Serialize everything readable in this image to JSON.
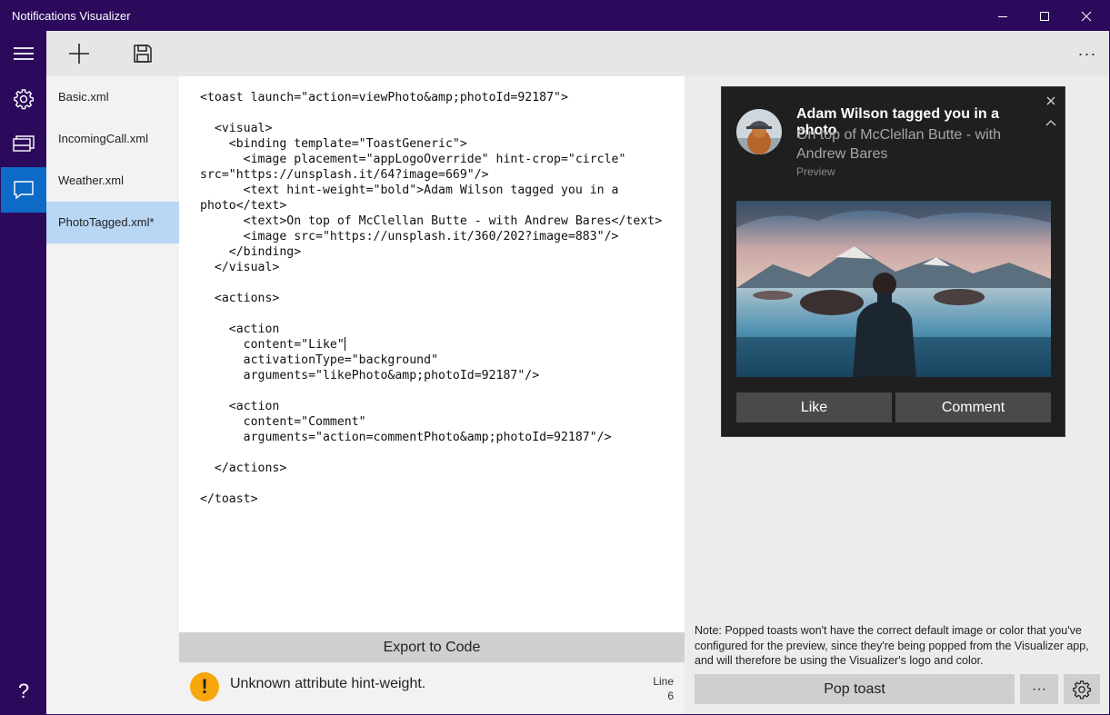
{
  "window": {
    "title": "Notifications Visualizer"
  },
  "nav": {
    "items": [
      {
        "icon": "hamburger-icon"
      },
      {
        "icon": "gear-icon"
      },
      {
        "icon": "gallery-icon"
      },
      {
        "icon": "message-icon",
        "active": true
      }
    ],
    "help_label": "?"
  },
  "toolbar": {
    "more_label": "···"
  },
  "files": [
    {
      "label": "Basic.xml"
    },
    {
      "label": "IncomingCall.xml"
    },
    {
      "label": "Weather.xml"
    },
    {
      "label": "PhotoTagged.xml*",
      "selected": true
    }
  ],
  "editor": {
    "code_before_caret": "<toast launch=\"action=viewPhoto&amp;photoId=92187\">\n\n  <visual>\n    <binding template=\"ToastGeneric\">\n      <image placement=\"appLogoOverride\" hint-crop=\"circle\"\nsrc=\"https://unsplash.it/64?image=669\"/>\n      <text hint-weight=\"bold\">Adam Wilson tagged you in a\nphoto</text>\n      <text>On top of McClellan Butte - with Andrew Bares</text>\n      <image src=\"https://unsplash.it/360/202?image=883\"/>\n    </binding>\n  </visual>\n\n  <actions>\n\n    <action\n      content=\"Like\"",
    "code_after_caret": "\n      activationType=\"background\"\n      arguments=\"likePhoto&amp;photoId=92187\"/>\n\n    <action\n      content=\"Comment\"\n      arguments=\"action=commentPhoto&amp;photoId=92187\"/>\n\n  </actions>\n\n</toast>",
    "export_label": "Export to Code"
  },
  "status": {
    "icon_glyph": "!",
    "message": "Unknown attribute hint-weight.",
    "line_label": "Line",
    "line_number": "6"
  },
  "toast": {
    "title": "Adam Wilson tagged you in a photo",
    "body": "On top of McClellan Butte - with Andrew Bares",
    "attribution": "Preview",
    "actions": [
      {
        "label": "Like"
      },
      {
        "label": "Comment"
      }
    ]
  },
  "preview": {
    "note": "Note: Popped toasts won't have the correct default image or color that you've configured for the preview, since they're being popped from the Visualizer app, and will therefore be using the Visualizer's logo and color.",
    "pop_label": "Pop toast",
    "more_label": "···"
  },
  "colors": {
    "accent": "#2b0a5c",
    "selection": "#b9d6f5",
    "active_nav": "#0e6ac7",
    "warning": "#f8a70b"
  }
}
